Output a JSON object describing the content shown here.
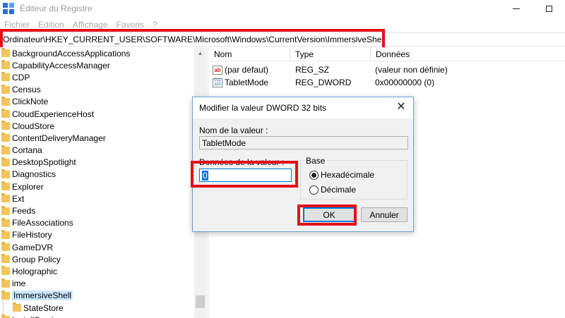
{
  "window": {
    "title": "Éditeur du Registre",
    "controls": {
      "minimize": "—",
      "maximize": "☐"
    }
  },
  "menu": [
    "Fichier",
    "Edition",
    "Affichage",
    "Favoris",
    "?"
  ],
  "address": "Ordinateur\\HKEY_CURRENT_USER\\SOFTWARE\\Microsoft\\Windows\\CurrentVersion\\ImmersiveShell",
  "tree": {
    "items": [
      {
        "label": "BackgroundAccessApplications",
        "child": false,
        "selected": false
      },
      {
        "label": "CapabilityAccessManager",
        "child": false,
        "selected": false
      },
      {
        "label": "CDP",
        "child": false,
        "selected": false
      },
      {
        "label": "Census",
        "child": false,
        "selected": false
      },
      {
        "label": "ClickNote",
        "child": false,
        "selected": false
      },
      {
        "label": "CloudExperienceHost",
        "child": false,
        "selected": false
      },
      {
        "label": "CloudStore",
        "child": false,
        "selected": false
      },
      {
        "label": "ContentDeliveryManager",
        "child": false,
        "selected": false
      },
      {
        "label": "Cortana",
        "child": false,
        "selected": false
      },
      {
        "label": "DesktopSpotlight",
        "child": false,
        "selected": false
      },
      {
        "label": "Diagnostics",
        "child": false,
        "selected": false
      },
      {
        "label": "Explorer",
        "child": false,
        "selected": false
      },
      {
        "label": "Ext",
        "child": false,
        "selected": false
      },
      {
        "label": "Feeds",
        "child": false,
        "selected": false
      },
      {
        "label": "FileAssociations",
        "child": false,
        "selected": false
      },
      {
        "label": "FileHistory",
        "child": false,
        "selected": false
      },
      {
        "label": "GameDVR",
        "child": false,
        "selected": false
      },
      {
        "label": "Group Policy",
        "child": false,
        "selected": false
      },
      {
        "label": "Holographic",
        "child": false,
        "selected": false
      },
      {
        "label": "ime",
        "child": false,
        "selected": false
      },
      {
        "label": "ImmersiveShell",
        "child": false,
        "selected": true
      },
      {
        "label": "StateStore",
        "child": true,
        "selected": false
      },
      {
        "label": "InstallService",
        "child": false,
        "selected": false
      }
    ]
  },
  "values": {
    "headers": [
      "Nom",
      "Type",
      "Données"
    ],
    "rows": [
      {
        "icon": "string-value-icon",
        "icon_text": "ab",
        "name": "(par défaut)",
        "type": "REG_SZ",
        "data": "(valeur non définie)"
      },
      {
        "icon": "dword-value-icon",
        "icon_text": "011 110",
        "name": "TabletMode",
        "type": "REG_DWORD",
        "data": "0x00000000 (0)"
      }
    ]
  },
  "dialog": {
    "title": "Modifier la valeur DWORD 32 bits",
    "close": "✕",
    "name_label": "Nom de la valeur :",
    "name_value": "TabletMode",
    "data_label": "Données de la valeur :",
    "data_value": "0",
    "base_label": "Base",
    "radio_hex": "Hexadécimale",
    "radio_dec": "Décimale",
    "base_selected": "hex",
    "ok": "OK",
    "cancel": "Annuler"
  },
  "colors": {
    "highlight": "#e3101a",
    "accent": "#0078d7",
    "folder": "#f2c45c",
    "selected_row": "#cce8ff"
  }
}
